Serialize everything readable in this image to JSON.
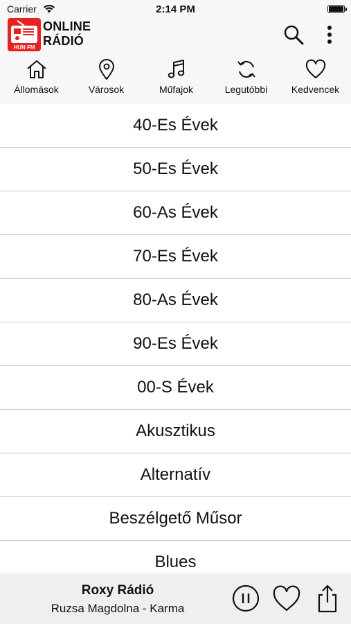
{
  "status": {
    "carrier": "Carrier",
    "time": "2:14 PM"
  },
  "header": {
    "logo_line1": "ONLINE",
    "logo_line2": "RÁDIÓ",
    "logo_badge": "HUN FM",
    "accent_color": "#e52222"
  },
  "tabs": [
    {
      "label": "Állomások",
      "icon": "home-icon"
    },
    {
      "label": "Városok",
      "icon": "location-pin-icon"
    },
    {
      "label": "Műfajok",
      "icon": "music-note-icon",
      "selected": true
    },
    {
      "label": "Legutóbbi",
      "icon": "refresh-icon"
    },
    {
      "label": "Kedvencek",
      "icon": "heart-icon"
    }
  ],
  "genres": [
    "40-Es Évek",
    "50-Es Évek",
    "60-As Évek",
    "70-Es Évek",
    "80-As Évek",
    "90-Es Évek",
    "00-S Évek",
    "Akusztikus",
    "Alternatív",
    "Beszélgető Műsor",
    "Blues"
  ],
  "player": {
    "station": "Roxy Rádió",
    "track": "Ruzsa Magdolna - Karma"
  }
}
